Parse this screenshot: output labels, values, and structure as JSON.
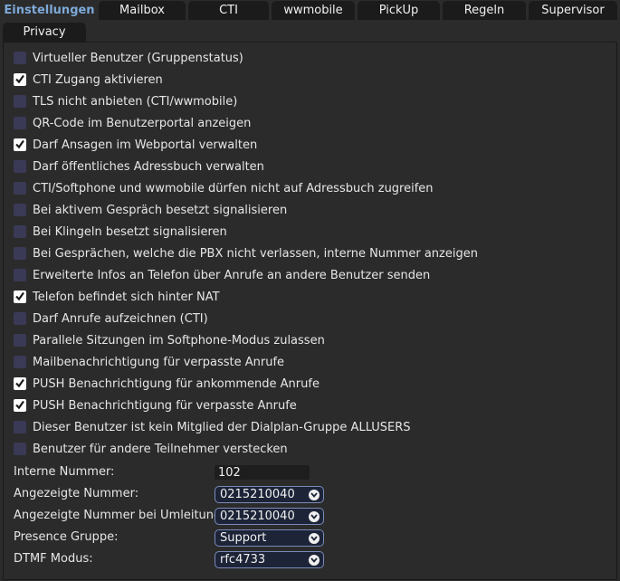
{
  "tabs": {
    "einstellungen": "Einstellungen",
    "mailbox": "Mailbox",
    "cti": "CTI",
    "wwmobile": "wwmobile",
    "pickup": "PickUp",
    "regeln": "Regeln",
    "supervisor": "Supervisor",
    "privacy": "Privacy"
  },
  "checkboxes": [
    {
      "label": "Virtueller Benutzer (Gruppenstatus)",
      "checked": false
    },
    {
      "label": "CTI Zugang aktivieren",
      "checked": true
    },
    {
      "label": "TLS nicht anbieten (CTI/wwmobile)",
      "checked": false
    },
    {
      "label": "QR-Code im Benutzerportal anzeigen",
      "checked": false
    },
    {
      "label": "Darf Ansagen im Webportal verwalten",
      "checked": true
    },
    {
      "label": "Darf öffentliches Adressbuch verwalten",
      "checked": false
    },
    {
      "label": "CTI/Softphone und wwmobile dürfen nicht auf Adressbuch zugreifen",
      "checked": false
    },
    {
      "label": "Bei aktivem Gespräch besetzt signalisieren",
      "checked": false
    },
    {
      "label": "Bei Klingeln besetzt signalisieren",
      "checked": false
    },
    {
      "label": "Bei Gesprächen, welche die PBX nicht verlassen, interne Nummer anzeigen",
      "checked": false
    },
    {
      "label": "Erweiterte Infos an Telefon über Anrufe an andere Benutzer senden",
      "checked": false
    },
    {
      "label": "Telefon befindet sich hinter NAT",
      "checked": true
    },
    {
      "label": "Darf Anrufe aufzeichnen (CTI)",
      "checked": false
    },
    {
      "label": "Parallele Sitzungen im Softphone-Modus zulassen",
      "checked": false
    },
    {
      "label": "Mailbenachrichtigung für verpasste Anrufe",
      "checked": false
    },
    {
      "label": "PUSH Benachrichtigung für ankommende Anrufe",
      "checked": true
    },
    {
      "label": "PUSH Benachrichtigung für verpasste Anrufe",
      "checked": true
    },
    {
      "label": "Dieser Benutzer ist kein Mitglied der Dialplan-Gruppe ALLUSERS",
      "checked": false
    },
    {
      "label": "Benutzer für andere Teilnehmer verstecken",
      "checked": false
    }
  ],
  "fields": {
    "interne_nummer": {
      "label": "Interne Nummer:",
      "value": "102"
    },
    "angezeigte_nummer": {
      "label": "Angezeigte Nummer:",
      "value": "0215210040"
    },
    "angezeigte_nummer_umleitung": {
      "label": "Angezeigte Nummer bei Umleitung:",
      "value": "0215210040"
    },
    "presence_gruppe": {
      "label": "Presence Gruppe:",
      "value": "Support"
    },
    "dtmf_modus": {
      "label": "DTMF Modus:",
      "value": "rfc4733"
    }
  },
  "colors": {
    "background": "#2b2b2b",
    "tab_background": "#1b1b1b",
    "active_tab_text": "#7da9d8",
    "checkbox_unchecked": "#3a3a56",
    "select_border": "#7a8bb8"
  },
  "icons": {
    "checkmark": "check-icon",
    "select_arrow": "chevron-down-icon"
  }
}
